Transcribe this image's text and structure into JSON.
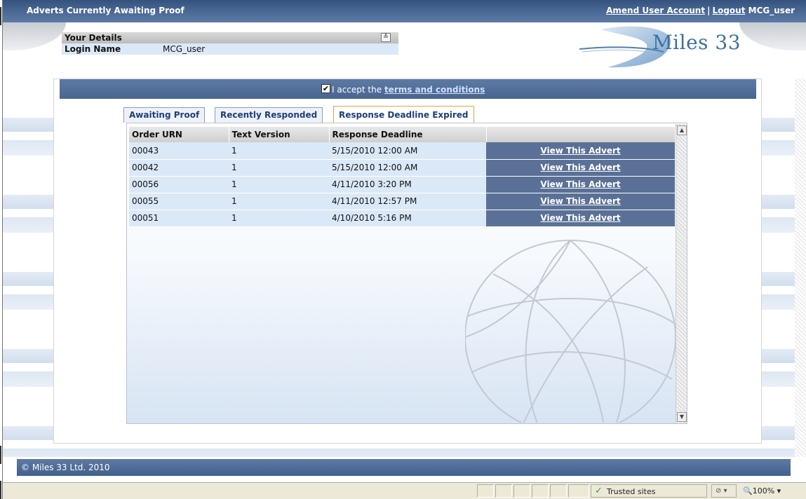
{
  "topbar": {
    "title": "Adverts Currently Awaiting Proof",
    "amend_link": "Amend User Account",
    "separator": "|",
    "logout_link": "Logout",
    "username": "MCG_user"
  },
  "details": {
    "header": "Your Details",
    "collapse_glyph": "≚",
    "login_label": "Login Name",
    "login_value": "MCG_user"
  },
  "logo": {
    "text": "Miles 33"
  },
  "terms": {
    "checkbox": "✔",
    "prefix": "I accept the ",
    "link": "terms and conditions",
    "checked": true
  },
  "tabs": [
    {
      "label": "Awaiting Proof",
      "active": false
    },
    {
      "label": "Recently Responded",
      "active": false
    },
    {
      "label": "Response Deadline Expired",
      "active": true
    }
  ],
  "grid": {
    "headers": [
      "Order URN",
      "Text Version",
      "Response Deadline",
      ""
    ],
    "rows": [
      {
        "urn": "00043",
        "version": "1",
        "deadline": "5/15/2010 12:00 AM",
        "action": "View This Advert"
      },
      {
        "urn": "00042",
        "version": "1",
        "deadline": "5/15/2010 12:00 AM",
        "action": "View This Advert"
      },
      {
        "urn": "00056",
        "version": "1",
        "deadline": "4/11/2010 3:20 PM",
        "action": "View This Advert"
      },
      {
        "urn": "00055",
        "version": "1",
        "deadline": "4/11/2010 12:57 PM",
        "action": "View This Advert"
      },
      {
        "urn": "00051",
        "version": "1",
        "deadline": "4/10/2010 5:16 PM",
        "action": "View This Advert"
      }
    ],
    "scroll_up": "▲",
    "scroll_down": "▼"
  },
  "footer": {
    "copyright": "© Miles 33 Ltd. 2010"
  },
  "statusbar": {
    "zone_icon": "✓",
    "zone": "Trusted sites",
    "protected_glyph": "⊘ ▾",
    "zoom": "🔍100%  ▾"
  },
  "colors": {
    "header_blue": "#4c6a96",
    "row_blue": "#dbe8f7",
    "button_blue": "#5a7096",
    "active_tab_border": "#e2a544"
  }
}
